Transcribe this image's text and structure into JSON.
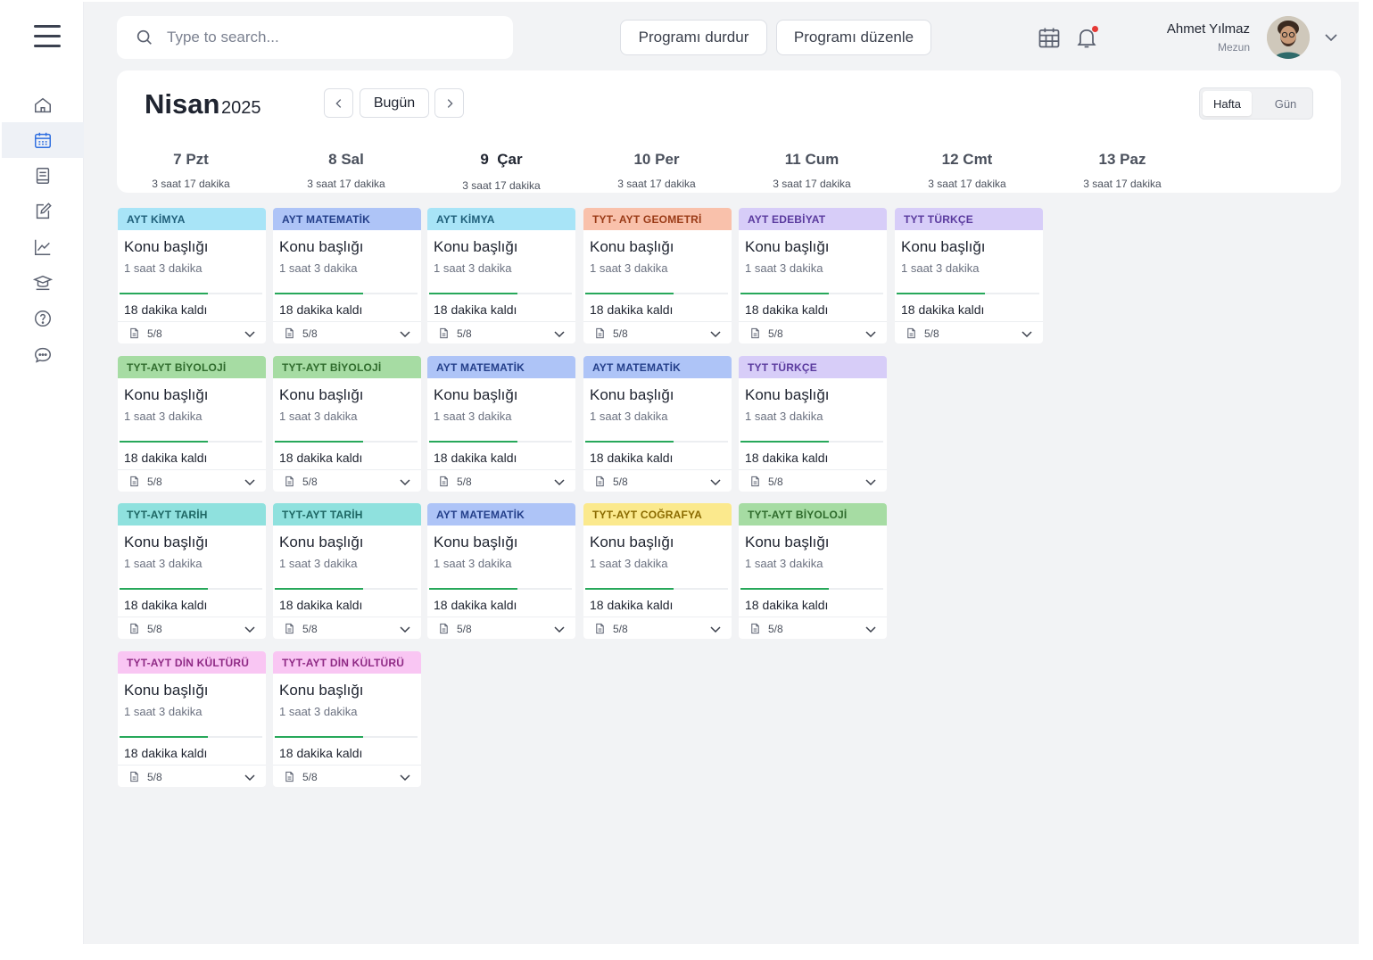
{
  "search": {
    "placeholder": "Type to search..."
  },
  "actions": {
    "stop_label": "Programı durdur",
    "edit_label": "Programı düzenle"
  },
  "user": {
    "name": "Ahmet Yılmaz",
    "role": "Mezun"
  },
  "calendar": {
    "month": "Nisan",
    "year": "2025",
    "today_label": "Bugün",
    "view_week": "Hafta",
    "view_day": "Gün",
    "days": [
      {
        "label": "7 Pzt",
        "duration": "3 saat 17 dakika"
      },
      {
        "label": "8 Sal",
        "duration": "3 saat 17 dakika"
      },
      {
        "label": "9  Çar",
        "duration": "3 saat 17 dakika"
      },
      {
        "label": "10 Per",
        "duration": "3 saat 17 dakika"
      },
      {
        "label": "11 Cum",
        "duration": "3 saat 17 dakika"
      },
      {
        "label": "12 Cmt",
        "duration": "3 saat 17 dakika"
      },
      {
        "label": "13 Paz",
        "duration": "3 saat 17 dakika"
      }
    ]
  },
  "colors": {
    "kimya": {
      "bg": "#a8e4f7",
      "fg": "#1f5f7a"
    },
    "matematik": {
      "bg": "#aec4f7",
      "fg": "#243f8a"
    },
    "geometri": {
      "bg": "#f9c1ab",
      "fg": "#9a3b17"
    },
    "edebiyat": {
      "bg": "#d7cdf8",
      "fg": "#5a3a9e"
    },
    "turkce": {
      "bg": "#d7cdf8",
      "fg": "#5a3a9e"
    },
    "biyoloji": {
      "bg": "#a6dca3",
      "fg": "#2f6b2c"
    },
    "tarih": {
      "bg": "#8fe1de",
      "fg": "#1d6663"
    },
    "cografya": {
      "bg": "#fbe98d",
      "fg": "#8a6a00"
    },
    "din": {
      "bg": "#f9c6f3",
      "fg": "#8f2a85"
    },
    "progress": "#27a85a"
  },
  "cards": [
    {
      "tag": "AYT KİMYA",
      "color": "kimya",
      "title": "Konu başlığı",
      "duration": "1 saat 3 dakika",
      "remaining": "18 dakika kaldı",
      "progress": 0.62,
      "docs": "5/8"
    },
    {
      "tag": "AYT  MATEMATİK",
      "color": "matematik",
      "title": "Konu başlığı",
      "duration": "1 saat 3 dakika",
      "remaining": "18 dakika kaldı",
      "progress": 0.62,
      "docs": "5/8"
    },
    {
      "tag": "AYT KİMYA",
      "color": "kimya",
      "title": "Konu başlığı",
      "duration": "1 saat 3 dakika",
      "remaining": "18 dakika kaldı",
      "progress": 0.62,
      "docs": "5/8"
    },
    {
      "tag": "TYT- AYT GEOMETRİ",
      "color": "geometri",
      "title": "Konu başlığı",
      "duration": "1 saat 3 dakika",
      "remaining": "18 dakika kaldı",
      "progress": 0.62,
      "docs": "5/8"
    },
    {
      "tag": "AYT EDEBİYAT",
      "color": "edebiyat",
      "title": "Konu başlığı",
      "duration": "1 saat 3 dakika",
      "remaining": "18 dakika kaldı",
      "progress": 0.62,
      "docs": "5/8"
    },
    {
      "tag": "TYT TÜRKÇE",
      "color": "turkce",
      "title": "Konu başlığı",
      "duration": "1 saat 3 dakika",
      "remaining": "18 dakika kaldı",
      "progress": 0.62,
      "docs": "5/8"
    },
    {
      "tag": "TYT-AYT BİYOLOJİ",
      "color": "biyoloji",
      "title": "Konu başlığı",
      "duration": "1 saat 3 dakika",
      "remaining": "18 dakika kaldı",
      "progress": 0.62,
      "docs": "5/8"
    },
    {
      "tag": "TYT-AYT BİYOLOJİ",
      "color": "biyoloji",
      "title": "Konu başlığı",
      "duration": "1 saat 3 dakika",
      "remaining": "18 dakika kaldı",
      "progress": 0.62,
      "docs": "5/8"
    },
    {
      "tag": "AYT  MATEMATİK",
      "color": "matematik",
      "title": "Konu başlığı",
      "duration": "1 saat 3 dakika",
      "remaining": "18 dakika kaldı",
      "progress": 0.62,
      "docs": "5/8"
    },
    {
      "tag": "AYT  MATEMATİK",
      "color": "matematik",
      "title": "Konu başlığı",
      "duration": "1 saat 3 dakika",
      "remaining": "18 dakika kaldı",
      "progress": 0.62,
      "docs": "5/8"
    },
    {
      "tag": "TYT TÜRKÇE",
      "color": "turkce",
      "title": "Konu başlığı",
      "duration": "1 saat 3 dakika",
      "remaining": "18 dakika kaldı",
      "progress": 0.62,
      "docs": "5/8"
    },
    {
      "tag": "TYT-AYT TARİH",
      "color": "tarih",
      "title": "Konu başlığı",
      "duration": "1 saat 3 dakika",
      "remaining": "18 dakika kaldı",
      "progress": 0.62,
      "docs": "5/8"
    },
    {
      "tag": "TYT-AYT TARİH",
      "color": "tarih",
      "title": "Konu başlığı",
      "duration": "1 saat 3 dakika",
      "remaining": "18 dakika kaldı",
      "progress": 0.62,
      "docs": "5/8"
    },
    {
      "tag": "AYT  MATEMATİK",
      "color": "matematik",
      "title": "Konu başlığı",
      "duration": "1 saat 3 dakika",
      "remaining": "18 dakika kaldı",
      "progress": 0.62,
      "docs": "5/8"
    },
    {
      "tag": "TYT-AYT  COĞRAFYA",
      "color": "cografya",
      "title": "Konu başlığı",
      "duration": "1 saat 3 dakika",
      "remaining": "18 dakika kaldı",
      "progress": 0.62,
      "docs": "5/8"
    },
    {
      "tag": "TYT-AYT BİYOLOJİ",
      "color": "biyoloji",
      "title": "Konu başlığı",
      "duration": "1 saat 3 dakika",
      "remaining": "18 dakika kaldı",
      "progress": 0.62,
      "docs": "5/8"
    },
    {
      "tag": "TYT-AYT DİN KÜLTÜRÜ",
      "color": "din",
      "title": "Konu başlığı",
      "duration": "1 saat 3 dakika",
      "remaining": "18 dakika kaldı",
      "progress": 0.62,
      "docs": "5/8"
    },
    {
      "tag": "TYT-AYT DİN KÜLTÜRÜ",
      "color": "din",
      "title": "Konu başlığı",
      "duration": "1 saat 3 dakika",
      "remaining": "18 dakika kaldı",
      "progress": 0.62,
      "docs": "5/8"
    }
  ],
  "sidebar": {
    "items": [
      {
        "icon": "home-icon"
      },
      {
        "icon": "calendar-icon",
        "active": true
      },
      {
        "icon": "book-icon"
      },
      {
        "icon": "edit-icon"
      },
      {
        "icon": "chart-icon"
      },
      {
        "icon": "graduate-icon"
      },
      {
        "icon": "help-icon"
      },
      {
        "icon": "chat-icon"
      }
    ]
  }
}
